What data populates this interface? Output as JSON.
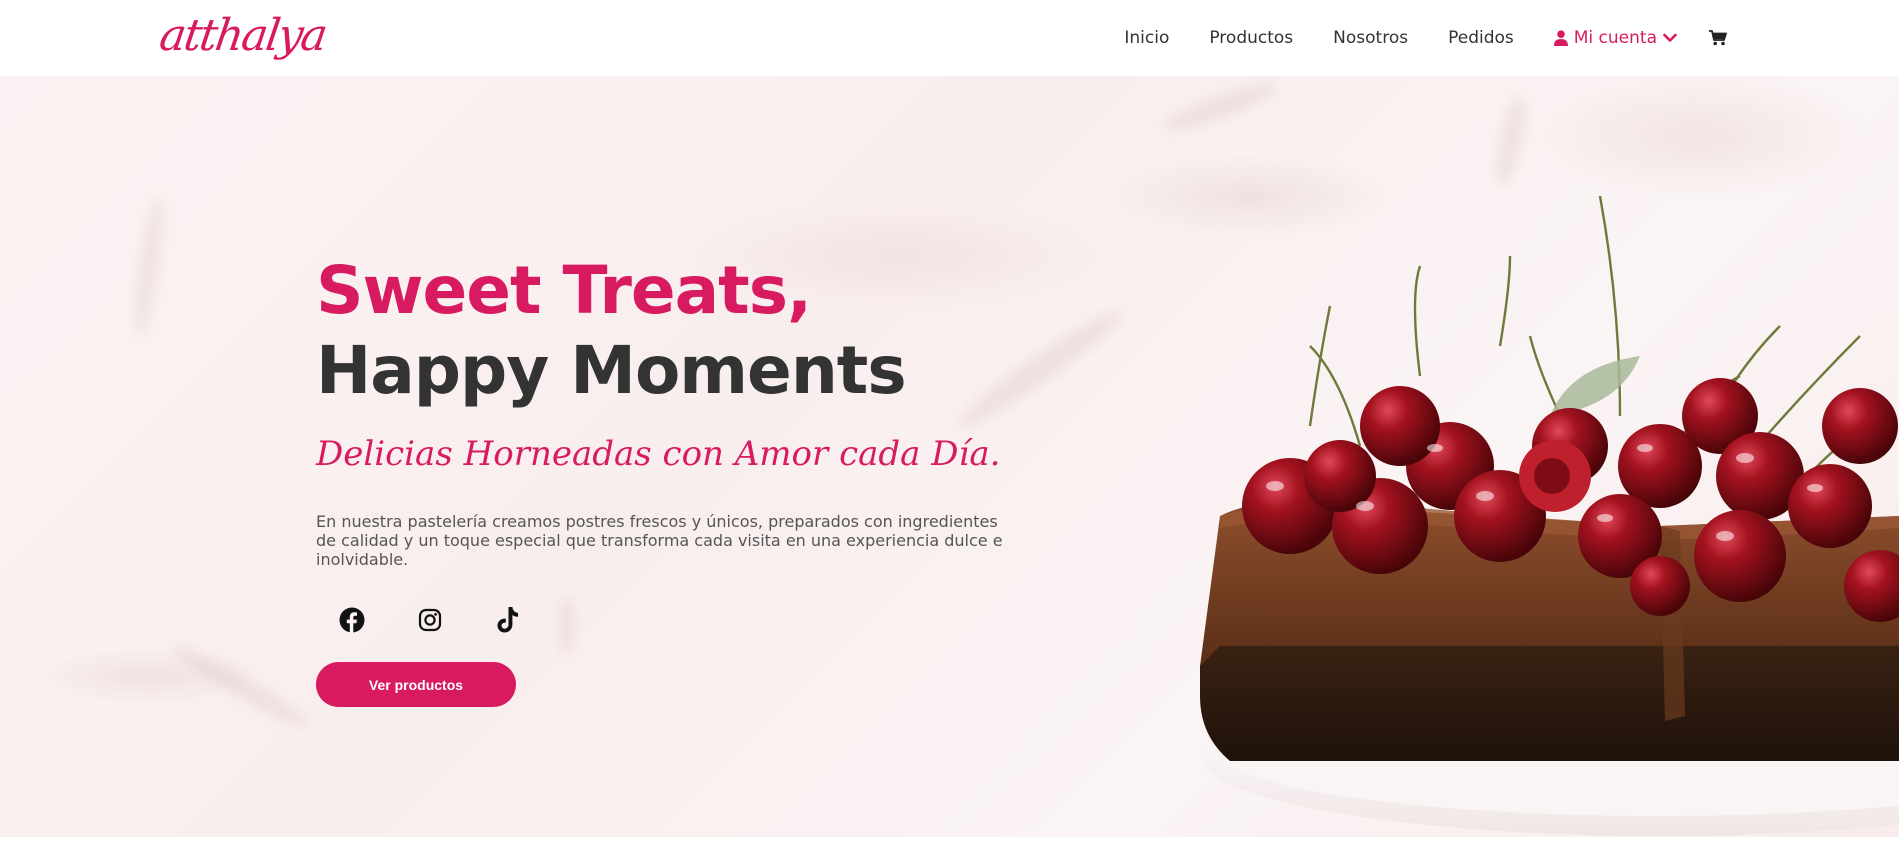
{
  "brand": {
    "logo_text": "atthalya",
    "accent_color": "#d81b60"
  },
  "nav": {
    "links": [
      "Inicio",
      "Productos",
      "Nosotros",
      "Pedidos"
    ],
    "account_label": "Mi cuenta",
    "account_icon": "user-icon",
    "cart_icon": "cart-icon"
  },
  "hero": {
    "title_line1": "Sweet Treats,",
    "title_line2": "Happy Moments",
    "tagline": "Delicias Horneadas con Amor cada Día.",
    "description": "En nuestra pastelería creamos postres frescos y únicos, preparados con ingredientes de calidad y un toque especial que transforma cada visita en una experiencia dulce e inolvidable.",
    "socials": [
      "facebook-icon",
      "instagram-icon",
      "tiktok-icon"
    ],
    "cta_label": "Ver productos"
  }
}
